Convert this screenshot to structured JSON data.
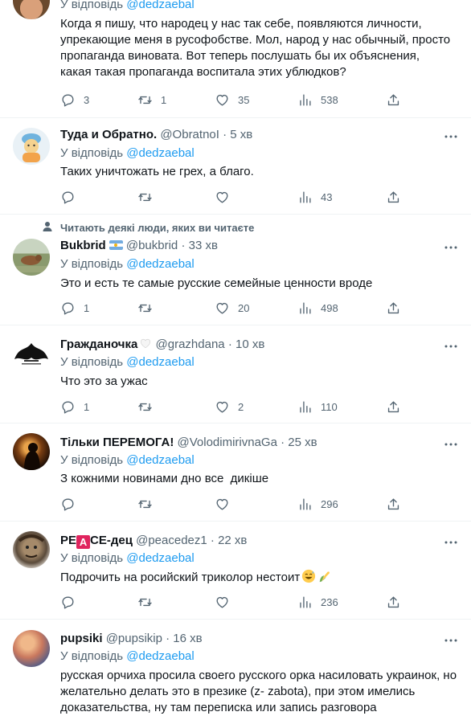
{
  "tweets": [
    {
      "reply_label": "У відповідь",
      "reply_to": "@dedzaebal",
      "text": "Когда я пишу, что народец у нас так себе, появляются личности, упрекающие меня в русофобстве. Мол, народ у нас обычный, просто пропаганда виновата. Вот теперь послушать бы их объяснения, какая такая пропаганда воспитала этих ублюдков?",
      "replies": "3",
      "retweets": "1",
      "likes": "35",
      "views": "538"
    },
    {
      "name": "Туда и Обратно.",
      "handle": "@ObratnoI",
      "dot": "·",
      "time": "5 хв",
      "reply_label": "У відповідь",
      "reply_to": "@dedzaebal",
      "text": "Таких уничтожать не грех, а благо.",
      "replies": "",
      "retweets": "",
      "likes": "",
      "views": "43"
    },
    {
      "social_context": "Читають деякі люди, яких ви читаєте",
      "name": "Bukbrid",
      "handle": "@bukbrid",
      "dot": "·",
      "time": "33 хв",
      "reply_label": "У відповідь",
      "reply_to": "@dedzaebal",
      "text": "Это и есть те самые русские семейные ценности вроде",
      "replies": "1",
      "retweets": "",
      "likes": "20",
      "views": "498"
    },
    {
      "name": "Гражданочка",
      "handle": "@grazhdana",
      "dot": "·",
      "time": "10 хв",
      "reply_label": "У відповідь",
      "reply_to": "@dedzaebal",
      "text": "Что это за ужас",
      "replies": "1",
      "retweets": "",
      "likes": "2",
      "views": "110"
    },
    {
      "name": "Тільки ПЕРЕМОГА!",
      "handle": "@VolodimirivnaGa",
      "dot": "·",
      "time": "25 хв",
      "reply_label": "У відповідь",
      "reply_to": "@dedzaebal",
      "text": "З кожними новинами дно все  дикіше",
      "replies": "",
      "retweets": "",
      "likes": "",
      "views": "296"
    },
    {
      "name_pre": "PE",
      "name_box": "A",
      "name_post": "CE-дец",
      "handle": "@peacedez1",
      "dot": "·",
      "time": "22 хв",
      "reply_label": "У відповідь",
      "reply_to": "@dedzaebal",
      "text": "Подрочить на росийский триколор нестоит",
      "replies": "",
      "retweets": "",
      "likes": "",
      "views": "236"
    },
    {
      "name": "pupsiki",
      "handle": "@pupsikip",
      "dot": "·",
      "time": "16 хв",
      "reply_label": "У відповідь",
      "reply_to": "@dedzaebal",
      "text": "русская орчиха просила своего русского орка насиловать украинок, но желательно делать это в презике (z- zabota), при этом имелись доказательства, ну там переписка или запись разговора"
    }
  ],
  "icons": {
    "reply": "reply-icon",
    "retweet": "retweet-icon",
    "like": "heart-icon",
    "views": "views-icon",
    "share": "share-icon",
    "more": "more-icon"
  },
  "colors": {
    "accent": "#1d9bf0",
    "secondary_text": "#536471",
    "primary_text": "#0f1419",
    "divider": "#eff3f4"
  }
}
